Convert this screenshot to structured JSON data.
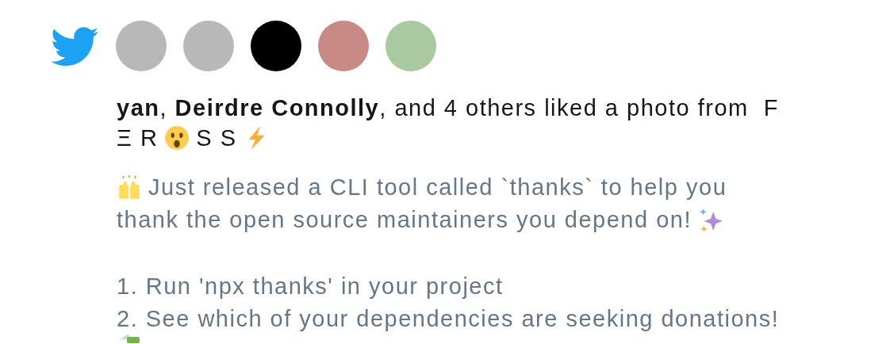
{
  "avatars": [
    {
      "color": "#b8b8b8"
    },
    {
      "color": "#b8b8b8"
    },
    {
      "color": "#000000"
    },
    {
      "color": "#c98a86"
    },
    {
      "color": "#a9c9a0"
    }
  ],
  "headline": [
    [
      {
        "kind": "text",
        "text": "**yan**, **Deirdre Connolly**, and 4 others liked a photo from  F"
      }
    ],
    [
      {
        "kind": "text",
        "text": "Ξ R"
      },
      {
        "kind": "face"
      },
      {
        "kind": "text",
        "text": "S S"
      },
      {
        "kind": "bolt"
      }
    ]
  ],
  "tweet": [
    [
      [
        {
          "kind": "hands"
        },
        {
          "kind": "text",
          "text": "Just released a CLI tool called `thanks` to help you"
        }
      ],
      [
        {
          "kind": "text",
          "text": "thank the open source maintainers you depend on!"
        },
        {
          "kind": "sparkles"
        }
      ]
    ],
    [
      [
        {
          "kind": "text",
          "text": "1. Run 'npx thanks' in your project"
        }
      ],
      [
        {
          "kind": "text",
          "text": "2. See which of your dependencies are seeking donations!"
        }
      ],
      [
        {
          "kind": "money"
        }
      ]
    ]
  ]
}
